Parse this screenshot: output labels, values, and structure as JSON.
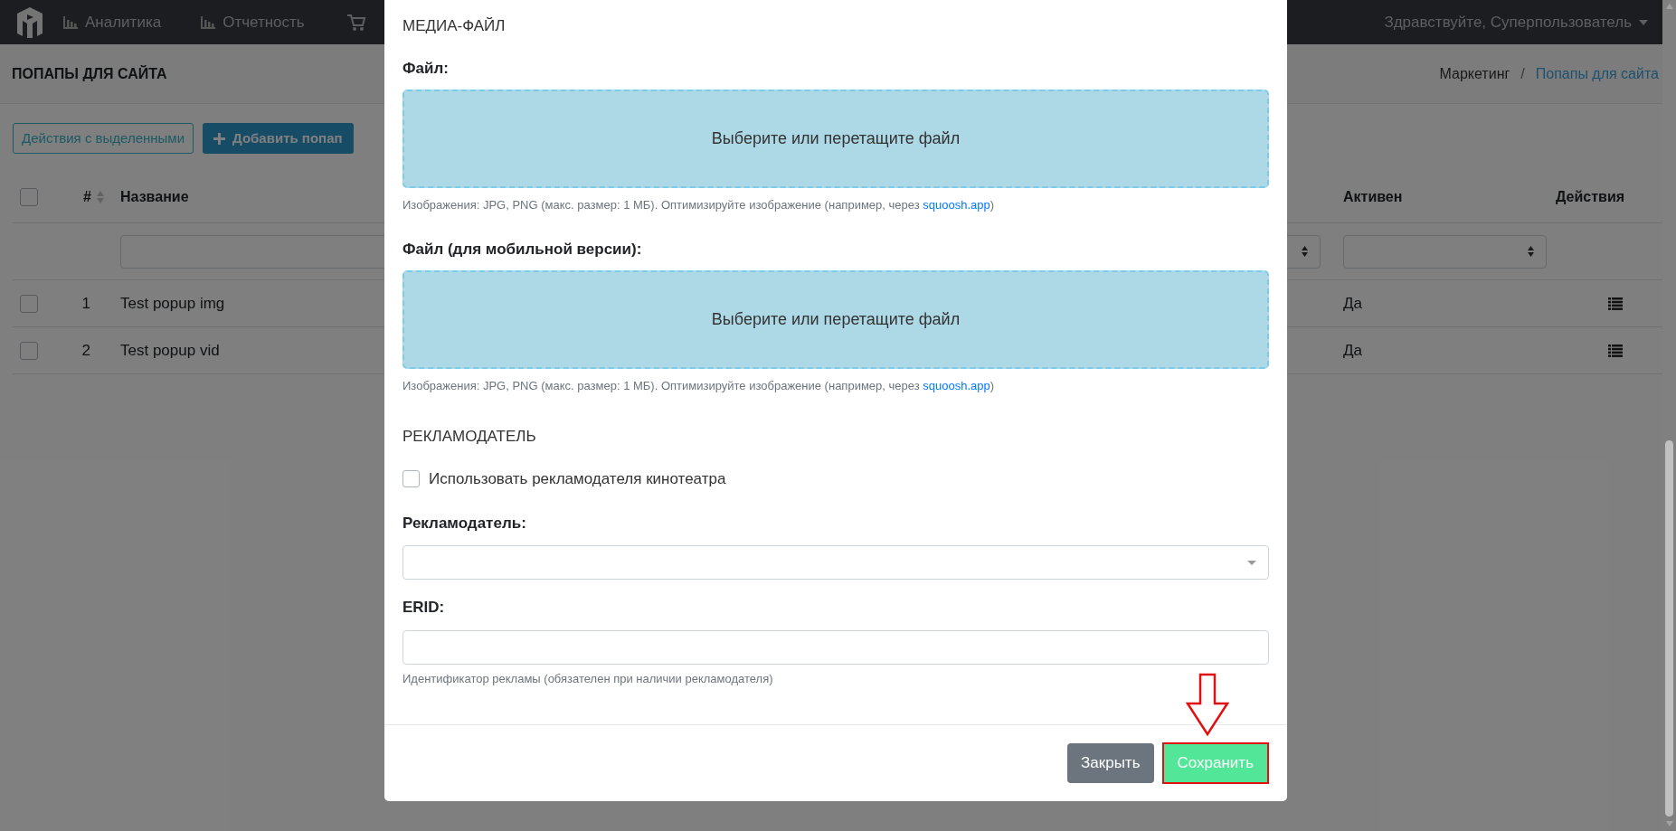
{
  "navbar": {
    "items": [
      {
        "label": "Аналитика"
      },
      {
        "label": "Отчетность"
      }
    ],
    "greeting": "Здравствуйте, Суперпользователь"
  },
  "page_header": {
    "title": "ПОПАПЫ ДЛЯ САЙТА",
    "breadcrumb_separator": "/",
    "breadcrumb": [
      {
        "label": "Маркетинг",
        "selected": false
      },
      {
        "label": "Попапы для сайта",
        "selected": true
      }
    ]
  },
  "toolbar": {
    "bulk_actions": "Действия с выделенными",
    "add_button": "Добавить попап"
  },
  "table": {
    "select_all": {
      "checked": false
    },
    "columns": {
      "number": "#",
      "name": "Название",
      "active": "Активен",
      "actions": "Действия"
    },
    "rows": [
      {
        "checked": false,
        "number": "1",
        "name": "Test popup img",
        "active": "Да"
      },
      {
        "checked": false,
        "number": "2",
        "name": "Test popup vid",
        "active": "Да"
      }
    ]
  },
  "modal": {
    "media_section": {
      "title": "МЕДИА-ФАЙЛ",
      "files": [
        {
          "label": "Файл:",
          "dropzone": "Выберите или перетащите файл",
          "hint": "Изображения: JPG, PNG (макс. размер: 1 МБ). Оптимизируйте изображение (например, через ",
          "link": "squoosh.app",
          "hint_end": ")"
        },
        {
          "label": "Файл (для мобильной версии):",
          "dropzone": "Выберите или перетащите файл",
          "hint": "Изображения: JPG, PNG (макс. размер: 1 МБ). Оптимизируйте изображение (например, через ",
          "link": "squoosh.app",
          "hint_end": ")"
        }
      ]
    },
    "advertiser_section": {
      "title": "РЕКЛАМОДАТЕЛЬ",
      "use_cinema": {
        "label": "Использовать рекламодателя кинотеатра",
        "checked": false
      },
      "advertiser": {
        "label": "Рекламодатель:"
      },
      "erid": {
        "label": "ERID:",
        "hint": "Идентификатор рекламы (обязателен при наличии рекламодателя)"
      }
    },
    "footer": {
      "close": "Закрыть",
      "save": {
        "label": "Сохранить",
        "highlighted": true
      }
    }
  }
}
